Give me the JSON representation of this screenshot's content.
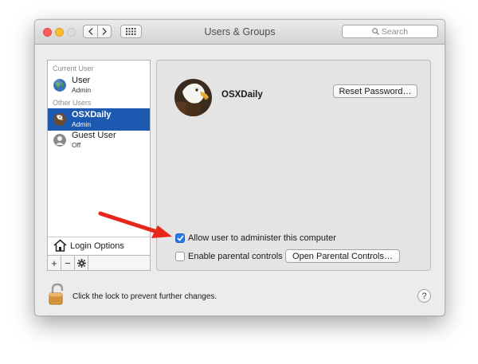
{
  "window": {
    "title": "Users & Groups",
    "search_placeholder": "Search"
  },
  "sidebar": {
    "current_user_heading": "Current User",
    "other_users_heading": "Other Users",
    "users": [
      {
        "name": "User",
        "role": "Admin",
        "selected": false
      },
      {
        "name": "OSXDaily",
        "role": "Admin",
        "selected": true
      },
      {
        "name": "Guest User",
        "role": "Off",
        "selected": false
      }
    ],
    "login_options_label": "Login Options",
    "add_label": "+",
    "remove_label": "−"
  },
  "main": {
    "account_name": "OSXDaily",
    "reset_password_label": "Reset Password…",
    "allow_admin_label": "Allow user to administer this computer",
    "allow_admin_checked": true,
    "parental_controls_label": "Enable parental controls",
    "parental_controls_checked": false,
    "open_parental_controls_label": "Open Parental Controls…"
  },
  "footer": {
    "lock_text": "Click the lock to prevent further changes.",
    "help_label": "?"
  },
  "colors": {
    "selection": "#1c5ab2",
    "checkbox_checked": "#2a78e3",
    "annotation_arrow": "#e8261c"
  }
}
